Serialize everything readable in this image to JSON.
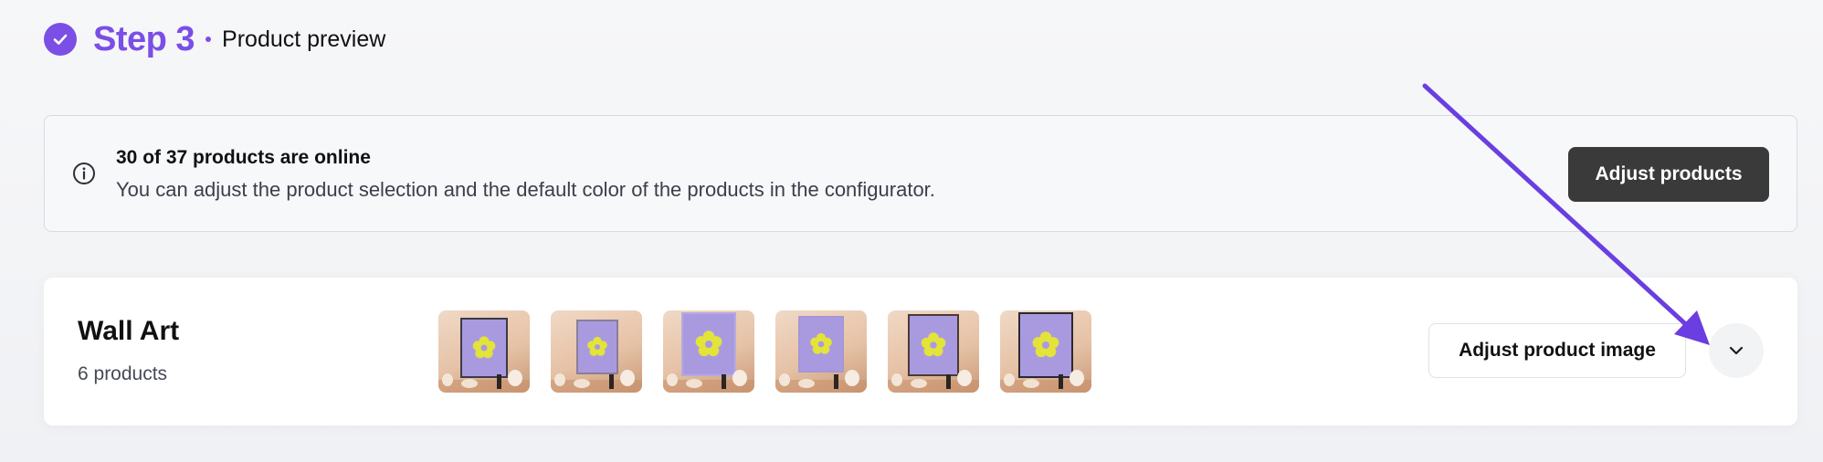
{
  "step": {
    "title": "Step 3",
    "subtitle": "Product preview"
  },
  "info": {
    "title": "30 of 37 products are online",
    "description": "You can adjust the product selection and the default color of the products in the configurator.",
    "button_label": "Adjust products"
  },
  "product_group": {
    "title": "Wall Art",
    "count": "6 products",
    "adjust_image_label": "Adjust product image",
    "thumbnails": [
      {
        "icon": "wall-art-thumbnail"
      },
      {
        "icon": "wall-art-thumbnail"
      },
      {
        "icon": "wall-art-thumbnail"
      },
      {
        "icon": "wall-art-thumbnail"
      },
      {
        "icon": "wall-art-thumbnail"
      },
      {
        "icon": "wall-art-thumbnail"
      }
    ]
  },
  "colors": {
    "accent": "#7b4ee6",
    "dark_button": "#3a3a3a",
    "poster_bg": "#a99ae0",
    "flower": "#e3e33a"
  },
  "icons": {
    "step_status": "check-circle-icon",
    "info": "info-icon",
    "expand": "chevron-down-icon"
  }
}
